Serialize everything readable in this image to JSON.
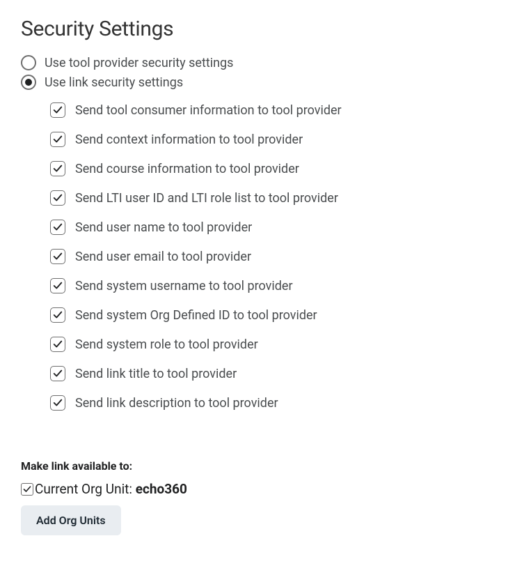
{
  "title": "Security Settings",
  "radios": {
    "use_tool_provider": {
      "label": "Use tool provider security settings",
      "selected": false
    },
    "use_link": {
      "label": "Use link security settings",
      "selected": true
    }
  },
  "checkboxes": [
    {
      "label": "Send tool consumer information to tool provider",
      "checked": true
    },
    {
      "label": "Send context information to tool provider",
      "checked": true
    },
    {
      "label": "Send course information to tool provider",
      "checked": true
    },
    {
      "label": "Send LTI user ID and LTI role list to tool provider",
      "checked": true
    },
    {
      "label": "Send user name to tool provider",
      "checked": true
    },
    {
      "label": "Send user email to tool provider",
      "checked": true
    },
    {
      "label": "Send system username to tool provider",
      "checked": true
    },
    {
      "label": "Send system Org Defined ID to tool provider",
      "checked": true
    },
    {
      "label": "Send system role to tool provider",
      "checked": true
    },
    {
      "label": "Send link title to tool provider",
      "checked": true
    },
    {
      "label": "Send link description to tool provider",
      "checked": true
    }
  ],
  "availability": {
    "title": "Make link available to:",
    "current_org_prefix": "Current Org Unit: ",
    "current_org_value": "echo360",
    "current_org_checked": true,
    "add_button": "Add Org Units"
  }
}
